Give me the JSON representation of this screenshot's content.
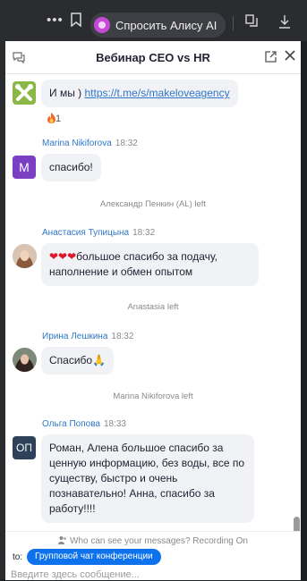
{
  "browser": {
    "alice_label": "Спросить Алису AI"
  },
  "chat": {
    "title": "Вебинар CEO vs HR",
    "messages": [
      {
        "text_prefix": "И мы ) ",
        "link": "https://t.me/s/makeloveagency",
        "reaction_count": "1"
      },
      {
        "sender": "Marina Nikiforova",
        "time": "18:32",
        "avatar_letter": "M",
        "avatar_color": "#7b3fc4",
        "text": "спасибо!"
      },
      {
        "system": "Александр Пенкин (AL) left"
      },
      {
        "sender": "Анастасия Тупицына",
        "time": "18:32",
        "hearts": "❤❤❤",
        "text": "большое спасибо за подачу, наполнение и обмен опытом"
      },
      {
        "system": "Anastasia left"
      },
      {
        "sender": "Ирина Лешкина",
        "time": "18:32",
        "text": "Спасибо🙏"
      },
      {
        "system": "Marina Nikiforova left"
      },
      {
        "sender": "Ольга Попова",
        "time": "18:33",
        "avatar_letter": "ОП",
        "avatar_color": "#2d4159",
        "text": "Роман, Алена большое спасибо за ценную информацию, без воды, все по существу, быстро и очень познавательно! Анна, спасибо за работу!!!!"
      }
    ],
    "privacy_text": "Who can see your messages? Recording On",
    "to_label": "to:",
    "recipient": "Групповой чат конференции",
    "input_placeholder": "Введите здесь сообщение..."
  },
  "colors": {
    "accent": "#0e72ed",
    "sender_name": "#2e77c8",
    "bubble": "#f1f2f5"
  },
  "icons": [
    "more-icon",
    "bookmark-icon",
    "alice-icon",
    "collections-icon",
    "download-icon",
    "chat-icon",
    "popout-icon",
    "close-icon",
    "flame-icon",
    "privacy-icon"
  ]
}
